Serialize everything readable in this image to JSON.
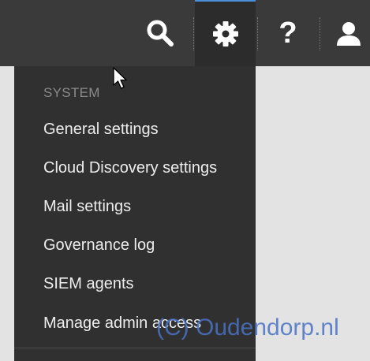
{
  "topbar": {
    "icons": [
      "search-icon",
      "gear-icon",
      "help-icon",
      "user-icon"
    ],
    "help_glyph": "?",
    "accent": "#4a90d9"
  },
  "menu": {
    "section_header": "SYSTEM",
    "items": [
      {
        "label": "General settings"
      },
      {
        "label": "Cloud Discovery settings"
      },
      {
        "label": "Mail settings"
      },
      {
        "label": "Governance log"
      },
      {
        "label": "SIEM agents"
      },
      {
        "label": "Manage admin access"
      }
    ]
  },
  "watermark": "(C) Oudendorp.nl"
}
